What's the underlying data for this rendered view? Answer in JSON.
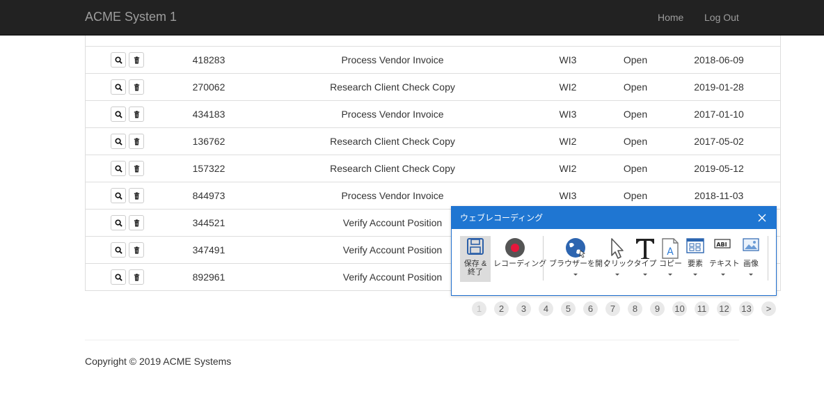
{
  "app": {
    "title": "ACME System 1"
  },
  "nav": {
    "home": "Home",
    "logout": "Log Out"
  },
  "rows": [
    {
      "id": "",
      "desc": "",
      "type": "",
      "status": "",
      "date": ""
    },
    {
      "id": "418283",
      "desc": "Process Vendor Invoice",
      "type": "WI3",
      "status": "Open",
      "date": "2018-06-09"
    },
    {
      "id": "270062",
      "desc": "Research Client Check Copy",
      "type": "WI2",
      "status": "Open",
      "date": "2019-01-28"
    },
    {
      "id": "434183",
      "desc": "Process Vendor Invoice",
      "type": "WI3",
      "status": "Open",
      "date": "2017-01-10"
    },
    {
      "id": "136762",
      "desc": "Research Client Check Copy",
      "type": "WI2",
      "status": "Open",
      "date": "2017-05-02"
    },
    {
      "id": "157322",
      "desc": "Research Client Check Copy",
      "type": "WI2",
      "status": "Open",
      "date": "2019-05-12"
    },
    {
      "id": "844973",
      "desc": "Process Vendor Invoice",
      "type": "WI3",
      "status": "Open",
      "date": "2018-11-03"
    },
    {
      "id": "344521",
      "desc": "Verify Account Position",
      "type": "",
      "status": "",
      "date": ""
    },
    {
      "id": "347491",
      "desc": "Verify Account Position",
      "type": "",
      "status": "",
      "date": ""
    },
    {
      "id": "892961",
      "desc": "Verify Account Position",
      "type": "",
      "status": "",
      "date": ""
    }
  ],
  "pagination": {
    "pages": [
      "1",
      "2",
      "3",
      "4",
      "5",
      "6",
      "7",
      "8",
      "9",
      "10",
      "11",
      "12",
      "13"
    ],
    "next": ">",
    "current": "1"
  },
  "footer": {
    "copyright": "Copyright © 2019 ACME Systems"
  },
  "recorder": {
    "title": "ウェブレコーディング",
    "tools": {
      "save": "保存 &\n終了",
      "recording": "レコーディング",
      "open_browser": "ブラウザーを開く",
      "click": "クリック",
      "type": "タイプ",
      "copy": "コピー",
      "element": "要素",
      "text": "テキスト",
      "image": "画像"
    }
  },
  "colors": {
    "navbar": "#222222",
    "accent": "#1f76d2",
    "record": "#e8173b"
  }
}
